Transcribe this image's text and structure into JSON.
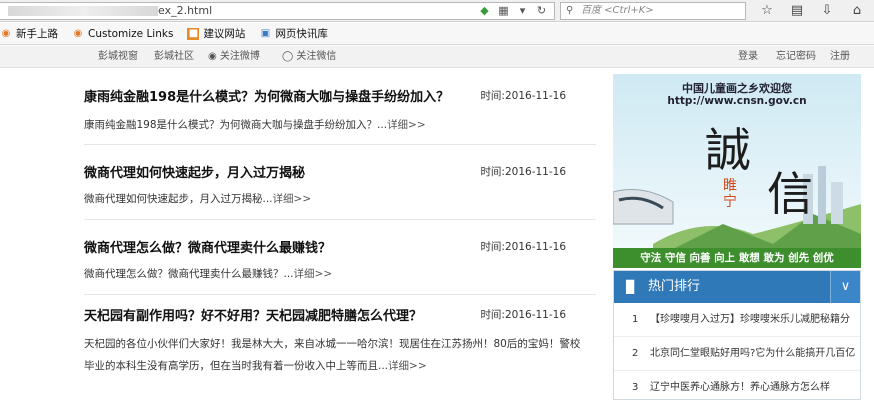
{
  "browser": {
    "url_text": "ex_2.html",
    "search_placeholder": "百度 <Ctrl+K>",
    "bookmarks": [
      {
        "label": "新手上路",
        "icon": "firefox-icon"
      },
      {
        "label": "Customize Links",
        "icon": "firefox-icon"
      },
      {
        "label": "建议网站",
        "icon": "suggest-icon"
      },
      {
        "label": "网页快讯库",
        "icon": "feed-icon"
      }
    ]
  },
  "topbar": {
    "left": [
      "彭城视窗",
      "彭城社区",
      "关注微博",
      "关注微信"
    ],
    "right": [
      "登录",
      "忘记密码",
      "注册"
    ]
  },
  "articles": [
    {
      "title": "康雨纯金融198是什么模式？为何微商大咖与操盘手纷纷加入？",
      "time": "时间:2016-11-16",
      "summary": "康雨纯金融198是什么模式？为何微商大咖与操盘手纷纷加入？...",
      "more": "详细>>"
    },
    {
      "title": "微商代理如何快速起步，月入过万揭秘",
      "time": "时间:2016-11-16",
      "summary": "微商代理如何快速起步，月入过万揭秘...",
      "more": "详细>>"
    },
    {
      "title": "微商代理怎么做？微商代理卖什么最赚钱？",
      "time": "时间:2016-11-16",
      "summary": "微商代理怎么做？微商代理卖什么最赚钱？...",
      "more": "详细>>"
    },
    {
      "title": "天杞园有副作用吗？好不好用？天杞园减肥特膳怎么代理？",
      "time": "时间:2016-11-16",
      "summary_line1": "天杞园的各位小伙伴们大家好！我是林大大，来自冰城一一哈尔滨！现居住在江苏扬州！80后的宝妈！警校",
      "summary_line2": "毕业的本科生没有高学历，但在当时我有着一份收入中上等而且...",
      "more": "详细>>"
    }
  ],
  "banner": {
    "slogan": "中国儿童画之乡欢迎您",
    "site": "http://www.cnsn.gov.cn",
    "char1": "誠",
    "char2": "信",
    "small_text": "睢宁",
    "motto": "守法 守信 向善 向上 敢想 敢为 创先 创优"
  },
  "hot": {
    "title": "热门排行",
    "items": [
      {
        "num": "1",
        "text": "【珍嗖嗖月入过万】珍嗖嗖米乐儿减肥秘籍分"
      },
      {
        "num": "2",
        "text": "北京同仁堂眼贴好用吗?它为什么能搞开几百亿"
      },
      {
        "num": "3",
        "text": "辽宁中医养心通脉方！养心通脉方怎么样"
      }
    ]
  }
}
